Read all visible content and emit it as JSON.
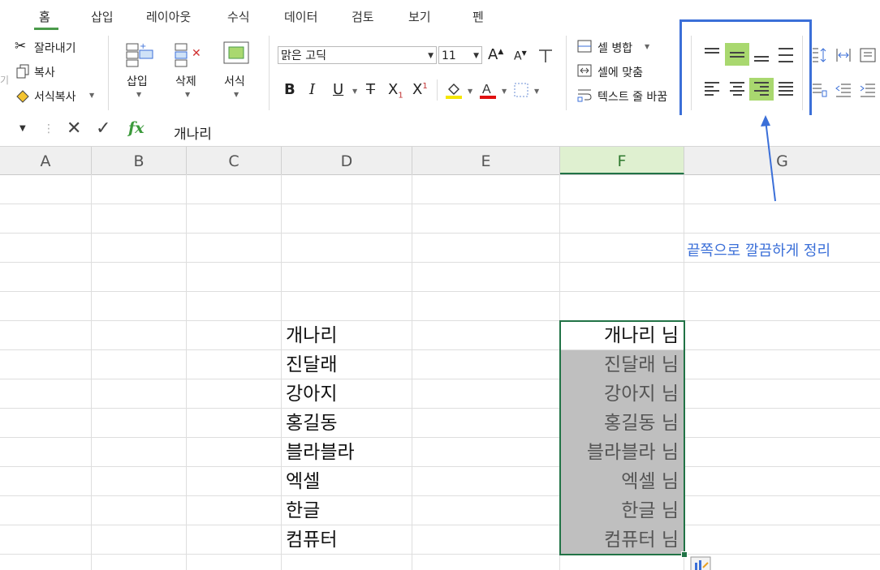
{
  "tabs": [
    {
      "label": "홈",
      "active": true
    },
    {
      "label": "삽입"
    },
    {
      "label": "레이아웃"
    },
    {
      "label": "수식"
    },
    {
      "label": "데이터"
    },
    {
      "label": "검토"
    },
    {
      "label": "보기"
    },
    {
      "label": "펜"
    }
  ],
  "clipboard": {
    "cut": "잘라내기",
    "copy": "복사",
    "format_painter": "서식복사",
    "left_cut_label": "기"
  },
  "cells_group": {
    "insert": "삽입",
    "delete": "삭제",
    "format": "서식"
  },
  "font": {
    "name": "맑은 고딕",
    "size": "11",
    "bold": "B",
    "italic": "I",
    "underline": "U",
    "strike": "T",
    "subscript": "X",
    "subscript_mark": "1",
    "superscript": "X",
    "superscript_mark": "1",
    "grow": "A",
    "shrink": "A"
  },
  "merge": {
    "merge": "셀 병합",
    "fit": "셀에 맞춤",
    "wrap": "텍스트 줄 바꿈"
  },
  "formula_bar": {
    "fx": "fx",
    "content": "개나리"
  },
  "columns": [
    "A",
    "B",
    "C",
    "D",
    "E",
    "F",
    "G"
  ],
  "selected_column": "F",
  "annotation": {
    "text": "끝쪽으로 깔끔하게 정리",
    "color": "#3b6fd8"
  },
  "accent": {
    "green": "#217346",
    "highlight": "#a9d86f",
    "annotation_blue": "#3b6fd8"
  },
  "column_d": [
    "개나리",
    "진달래",
    "강아지",
    "홍길동",
    "블라블라",
    "엑셀",
    "한글",
    "컴퓨터"
  ],
  "column_f": [
    "개나리 님",
    "진달래 님",
    "강아지 님",
    "홍길동 님",
    "블라블라 님",
    "엑셀 님",
    "한글 님",
    "컴퓨터 님"
  ]
}
